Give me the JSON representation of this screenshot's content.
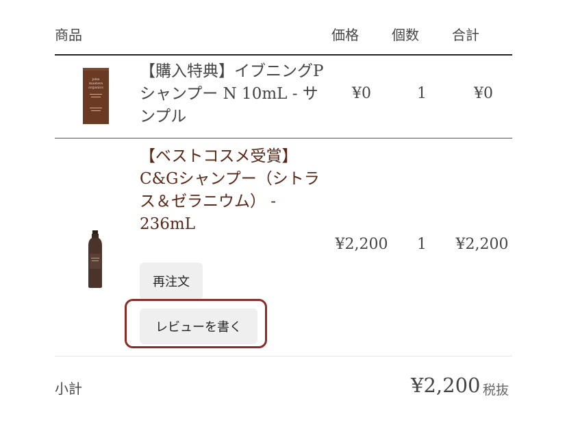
{
  "table": {
    "headers": {
      "product": "商品",
      "price": "価格",
      "qty": "個数",
      "total": "合計"
    },
    "rows": [
      {
        "name": "【購入特典】イブニングPシャンプー N 10mL - サンプル",
        "price": "¥0",
        "qty": "1",
        "total": "¥0",
        "thumb_icon": "sample-sachet-icon",
        "thumb_text": "john masters organics"
      },
      {
        "name": "【ベストコスメ受賞】C&Gシャンプー（シトラス＆ゼラニウム） - 236mL",
        "price": "¥2,200",
        "qty": "1",
        "total": "¥2,200",
        "thumb_icon": "shampoo-bottle-icon",
        "reorder_label": "再注文",
        "review_label": "レビューを書く"
      }
    ]
  },
  "summary": {
    "subtotal_label": "小計",
    "subtotal_value": "¥2,200",
    "tax_note": "税抜"
  },
  "colors": {
    "highlight_border": "#8b2b26",
    "link_name": "#5a2716",
    "button_bg": "#efefef"
  }
}
